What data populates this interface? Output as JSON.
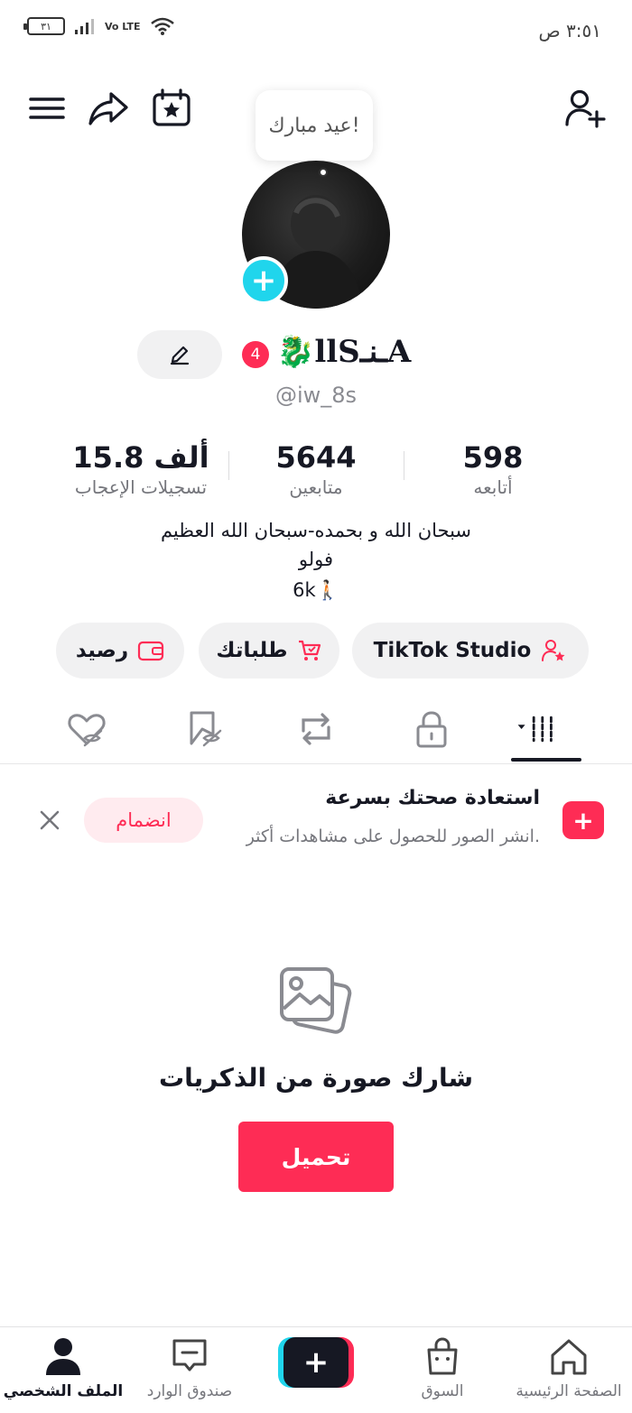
{
  "status_bar": {
    "time": "٣:٥١ ص",
    "battery": "٣١",
    "network": "Vo LTE"
  },
  "header": {
    "icons": [
      "menu-icon",
      "share-icon",
      "calendar-star-icon",
      "add-friend-icon"
    ],
    "bubble_text": "عيد مبارك!"
  },
  "profile": {
    "display_name": "🐉llSـنـA",
    "badge": "4",
    "username": "@iw_8s"
  },
  "stats": [
    {
      "value": "598",
      "label": "أتابعه"
    },
    {
      "value": "5644",
      "label": "متابعين"
    },
    {
      "value": "15.8 ألف",
      "label": "تسجيلات الإعجاب"
    }
  ],
  "bio": [
    "سبحان الله و بحمده-سبحان الله العظيم",
    "فولو",
    "6k🚶🏻"
  ],
  "actions": {
    "studio": "TikTok Studio",
    "orders": "طلباتك",
    "balance": "رصيد"
  },
  "tabs": [
    "videos",
    "private",
    "reposts",
    "favorites",
    "liked"
  ],
  "banner": {
    "title": "استعادة صحتك بسرعة",
    "subtitle": "انشر الصور للحصول على مشاهدات أكثر.",
    "join_label": "انضمام"
  },
  "empty_state": {
    "title": "شارك صورة من الذكريات",
    "button": "تحميل"
  },
  "bottom_nav": {
    "home": "الصفحة الرئيسية",
    "shop": "السوق",
    "inbox": "صندوق الوارد",
    "profile": "الملف الشخصي"
  },
  "colors": {
    "accent": "#fe2c55",
    "cyan": "#20d5ec",
    "text": "#161823",
    "muted": "#75767c"
  }
}
